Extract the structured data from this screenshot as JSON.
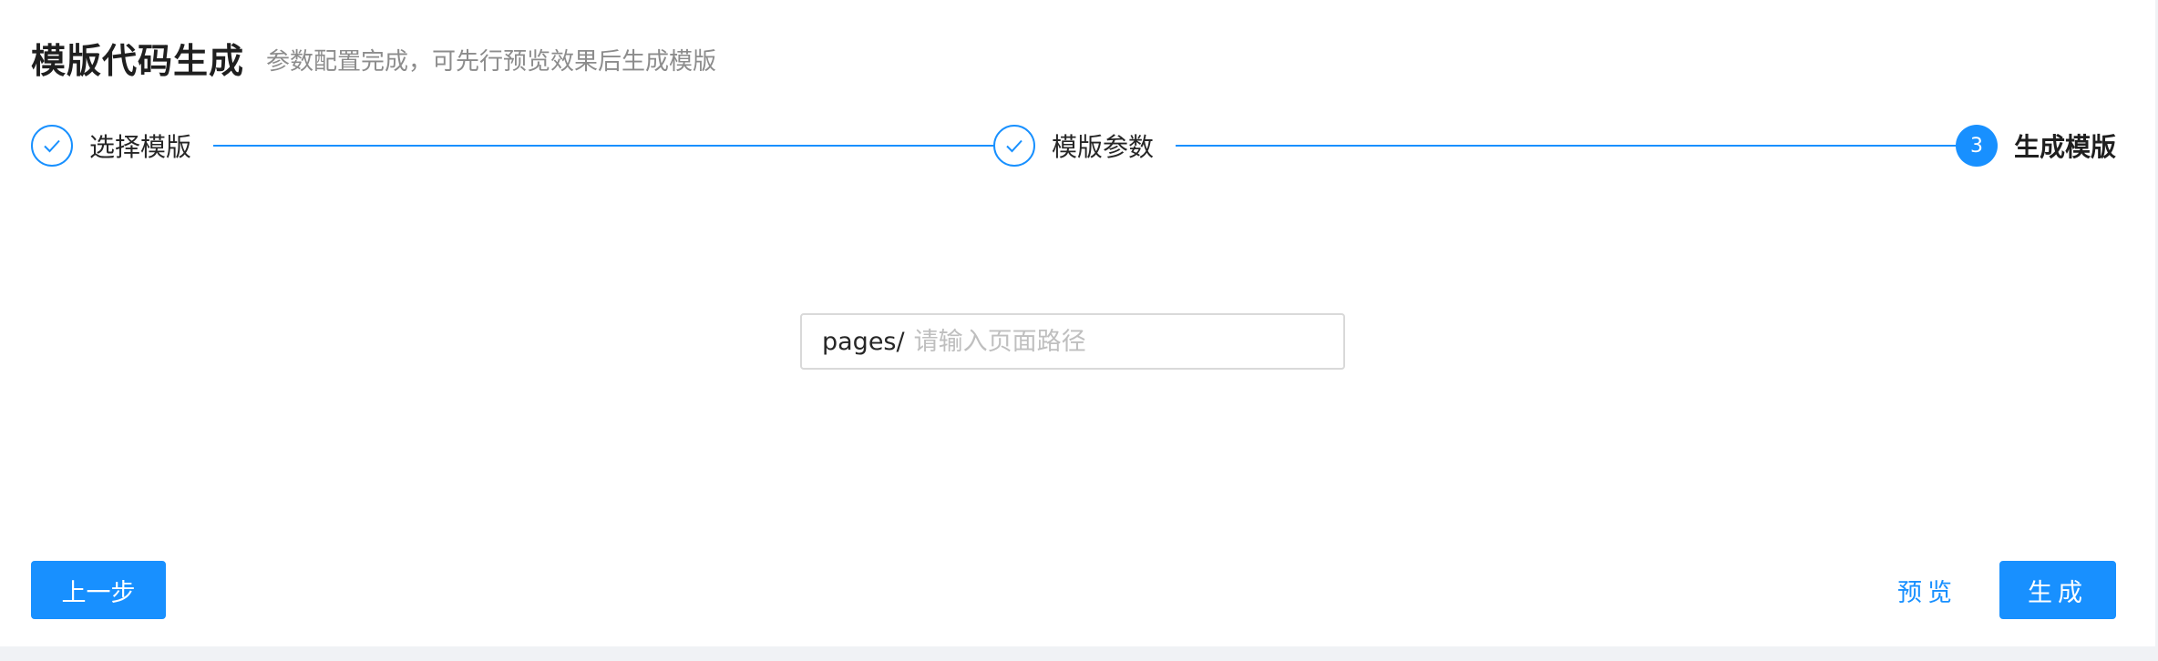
{
  "header": {
    "title": "模版代码生成",
    "subtitle": "参数配置完成，可先行预览效果后生成模版"
  },
  "steps": [
    {
      "label": "选择模版",
      "status": "done",
      "icon": "check-icon"
    },
    {
      "label": "模版参数",
      "status": "done",
      "icon": "check-icon"
    },
    {
      "label": "生成模版",
      "status": "current",
      "number": "3"
    }
  ],
  "path_input": {
    "prefix": "pages/",
    "placeholder": "请输入页面路径",
    "value": ""
  },
  "buttons": {
    "prev_label": "上一步",
    "preview_label": "预览",
    "generate_label": "生成"
  },
  "colors": {
    "primary": "#1890ff",
    "page_background": "#f0f2f5"
  }
}
